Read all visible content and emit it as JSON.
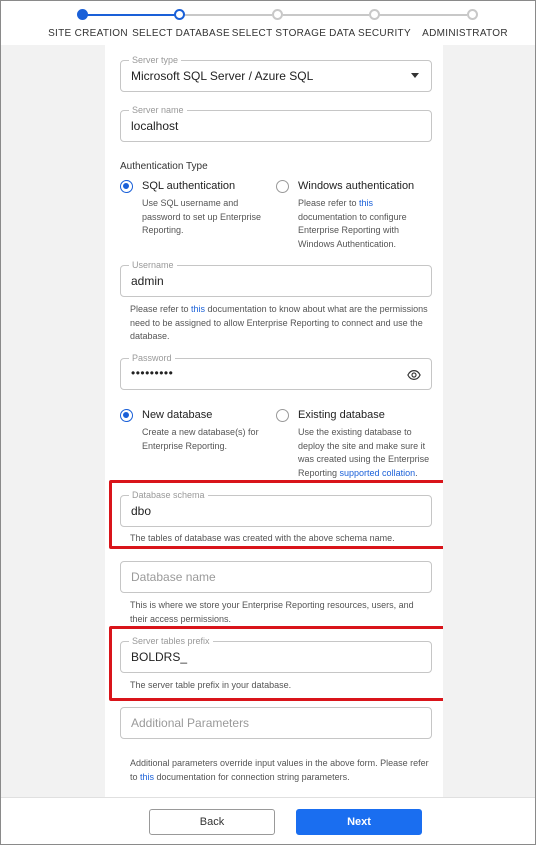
{
  "stepper": {
    "steps": [
      {
        "label": "SITE CREATION",
        "state": "done"
      },
      {
        "label": "SELECT DATABASE",
        "state": "active"
      },
      {
        "label": "SELECT STORAGE",
        "state": "pending"
      },
      {
        "label": "DATA SECURITY",
        "state": "pending"
      },
      {
        "label": "ADMINISTRATOR",
        "state": "pending"
      }
    ]
  },
  "form": {
    "server_type": {
      "label": "Server type",
      "value": "Microsoft SQL Server / Azure SQL"
    },
    "server_name": {
      "label": "Server name",
      "value": "localhost"
    },
    "auth_title": "Authentication Type",
    "auth_sql": {
      "label": "SQL authentication",
      "checked": true,
      "desc": "Use SQL username and password to set up Enterprise Reporting."
    },
    "auth_windows": {
      "label": "Windows authentication",
      "checked": false,
      "desc_pre": "Please refer to ",
      "desc_link": "this",
      "desc_post": " documentation to configure Enterprise Reporting with Windows Authentication."
    },
    "username": {
      "label": "Username",
      "value": "admin"
    },
    "username_help": {
      "pre": "Please refer to ",
      "link": "this",
      "post": " documentation to know about what are the permissions need to be assigned to allow Enterprise Reporting to connect and use the database."
    },
    "password": {
      "label": "Password",
      "value": "•••••••••",
      "icon": "eye-icon"
    },
    "db_new": {
      "label": "New database",
      "checked": true,
      "desc": "Create a new database(s) for Enterprise Reporting."
    },
    "db_existing": {
      "label": "Existing database",
      "checked": false,
      "desc_pre": "Use the existing database to deploy the site and make sure it was created using the Enterprise Reporting ",
      "desc_link": "supported collation",
      "desc_post": "."
    },
    "db_schema": {
      "label": "Database schema",
      "value": "dbo",
      "help": "The tables of database was created with the above schema name."
    },
    "db_name": {
      "placeholder": "Database name",
      "help": "This is where we store your Enterprise Reporting resources, users, and their access permissions."
    },
    "table_prefix": {
      "label": "Server tables prefix",
      "value": "BOLDRS_",
      "help": "The server table prefix in your database."
    },
    "additional": {
      "placeholder": "Additional Parameters",
      "help_pre": "Additional parameters override input values in the above form. Please refer to ",
      "help_link": "this",
      "help_post": " documentation for connection string parameters."
    }
  },
  "footer": {
    "back_label": "Back",
    "next_label": "Next"
  },
  "colors": {
    "accent": "#1a60d8",
    "highlight": "#d9141a",
    "next_button": "#1a6ef0"
  }
}
